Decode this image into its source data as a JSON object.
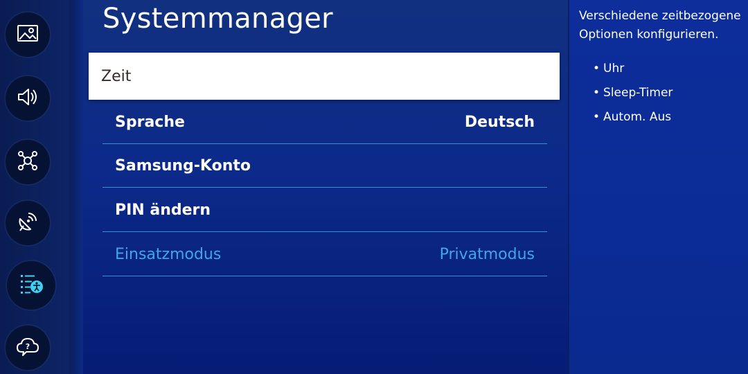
{
  "sidebar": {
    "items": [
      {
        "icon": "picture-icon"
      },
      {
        "icon": "sound-icon"
      },
      {
        "icon": "network-icon"
      },
      {
        "icon": "broadcast-icon"
      },
      {
        "icon": "general-settings-icon",
        "active": true
      },
      {
        "icon": "support-icon"
      }
    ],
    "accent_color": "#3fd1f0"
  },
  "main": {
    "title": "Systemmanager",
    "items": [
      {
        "label": "Zeit",
        "value": "",
        "state": "focused"
      },
      {
        "label": "Sprache",
        "value": "Deutsch",
        "state": "normal"
      },
      {
        "label": "Samsung-Konto",
        "value": "",
        "state": "normal"
      },
      {
        "label": "PIN ändern",
        "value": "",
        "state": "normal"
      },
      {
        "label": "Einsatzmodus",
        "value": "Privatmodus",
        "state": "disabled"
      }
    ]
  },
  "help": {
    "description": "Verschiedene zeitbezogene Optionen konfigurieren.",
    "bullet": "•",
    "items": [
      "Uhr",
      "Sleep-Timer",
      "Autom. Aus"
    ]
  },
  "colors": {
    "background": "#0c2a8a",
    "focus": "#ffffff",
    "disabled_text": "#3fa6ec",
    "divider": "#3b8fd9"
  }
}
